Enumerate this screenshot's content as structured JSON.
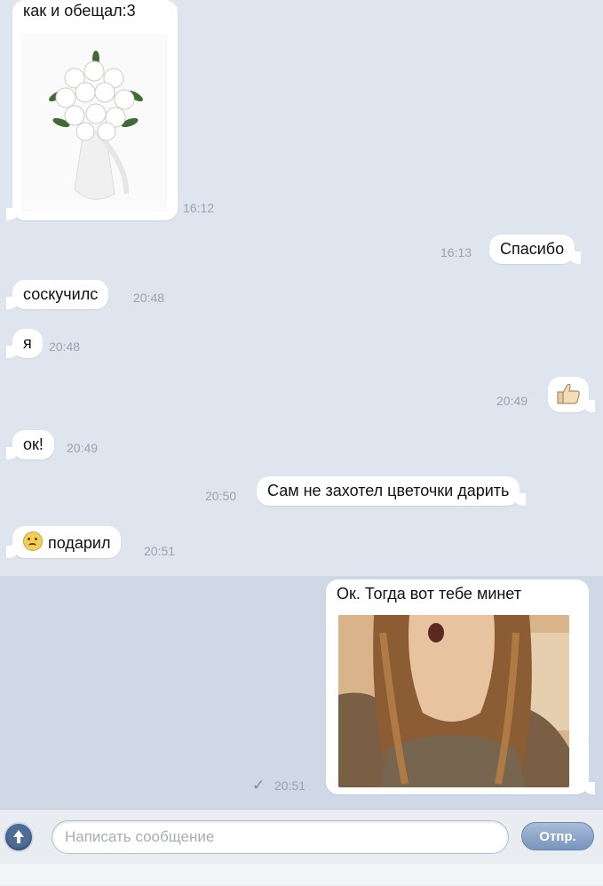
{
  "messages": [
    {
      "text": "как и обещал:3",
      "time": "16:12",
      "attachment": "bouquet-photo"
    },
    {
      "text": "Спасибо",
      "time": "16:13"
    },
    {
      "text": "соскучилс",
      "time": "20:48"
    },
    {
      "text": "я",
      "time": "20:48"
    },
    {
      "emoji": "thumbs-up-icon",
      "time": "20:49"
    },
    {
      "text": "ок!",
      "time": "20:49"
    },
    {
      "text": "Сам не захотел цветочки дарить",
      "time": "20:50"
    },
    {
      "text": "подарил",
      "time": "20:51",
      "emoji": "sad-face-icon"
    },
    {
      "text": "Ок. Тогда вот тебе минет",
      "time": "20:51",
      "status": "✓",
      "attachment": "girl-photo"
    }
  ],
  "composer": {
    "placeholder": "Написать сообщение",
    "send_label": "Отпр.",
    "attach_icon": "arrow-up-icon"
  },
  "colors": {
    "background": "#dfe5ee",
    "bubble": "#ffffff",
    "send_button": "#8aa3c6",
    "time_text": "#9aa3b0"
  }
}
